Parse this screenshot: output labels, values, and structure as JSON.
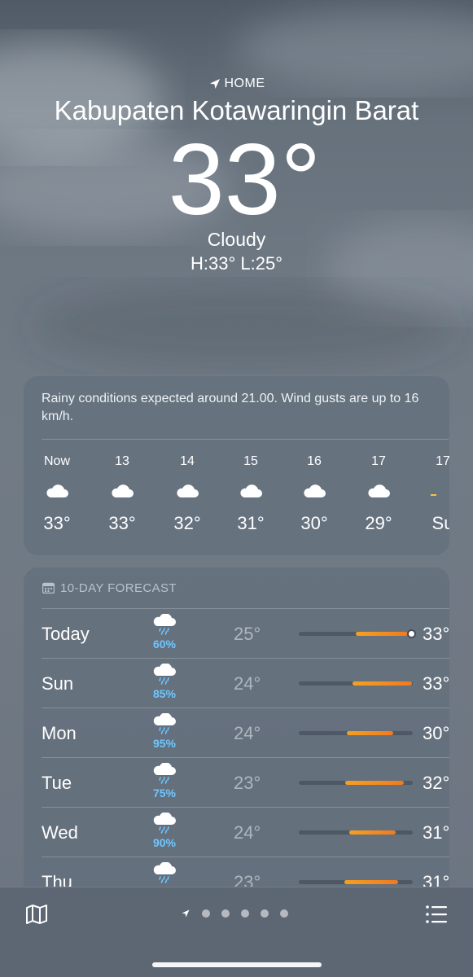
{
  "header": {
    "location_label": "HOME",
    "city": "Kabupaten Kotawaringin Barat",
    "temperature": "33°",
    "condition": "Cloudy",
    "high_low": "H:33°  L:25°"
  },
  "hourly": {
    "summary": "Rainy conditions expected around 21.00. Wind gusts are up to 16 km/h.",
    "items": [
      {
        "time": "Now",
        "icon": "cloud-icon",
        "temp": "33°"
      },
      {
        "time": "13",
        "icon": "cloud-icon",
        "temp": "33°"
      },
      {
        "time": "14",
        "icon": "cloud-icon",
        "temp": "32°"
      },
      {
        "time": "15",
        "icon": "cloud-icon",
        "temp": "31°"
      },
      {
        "time": "16",
        "icon": "cloud-icon",
        "temp": "30°"
      },
      {
        "time": "17",
        "icon": "cloud-icon",
        "temp": "29°"
      },
      {
        "time": "17",
        "icon": "sunset-icon",
        "temp": "Su"
      }
    ]
  },
  "daily": {
    "title": "10-DAY FORECAST",
    "range_min": 23,
    "range_max": 33,
    "current_temp": 33,
    "days": [
      {
        "day": "Today",
        "icon": "rain-cloud-icon",
        "precip": "60%",
        "low": "25°",
        "high": "33°",
        "low_val": 25,
        "high_val": 33,
        "bar_start": 0.5,
        "bar_end": 0.96
      },
      {
        "day": "Sun",
        "icon": "rain-cloud-icon",
        "precip": "85%",
        "low": "24°",
        "high": "33°",
        "low_val": 24,
        "high_val": 33,
        "bar_start": 0.47,
        "bar_end": 0.99
      },
      {
        "day": "Mon",
        "icon": "rain-cloud-icon",
        "precip": "95%",
        "low": "24°",
        "high": "30°",
        "low_val": 24,
        "high_val": 30,
        "bar_start": 0.42,
        "bar_end": 0.83
      },
      {
        "day": "Tue",
        "icon": "rain-cloud-icon",
        "precip": "75%",
        "low": "23°",
        "high": "32°",
        "low_val": 23,
        "high_val": 32,
        "bar_start": 0.41,
        "bar_end": 0.92
      },
      {
        "day": "Wed",
        "icon": "rain-cloud-icon",
        "precip": "90%",
        "low": "24°",
        "high": "31°",
        "low_val": 24,
        "high_val": 31,
        "bar_start": 0.44,
        "bar_end": 0.85
      },
      {
        "day": "Thu",
        "icon": "rain-cloud-icon",
        "precip": "",
        "low": "23°",
        "high": "31°",
        "low_val": 23,
        "high_val": 31,
        "bar_start": 0.4,
        "bar_end": 0.87
      }
    ]
  },
  "toolbar": {
    "map_icon": "map-icon",
    "list_icon": "list-icon",
    "page_count": 6,
    "current_page": 0
  },
  "colors": {
    "bar_gradient_start": "#f5a020",
    "bar_gradient_end": "#f07a22",
    "precip_text": "#6ec6ff"
  }
}
